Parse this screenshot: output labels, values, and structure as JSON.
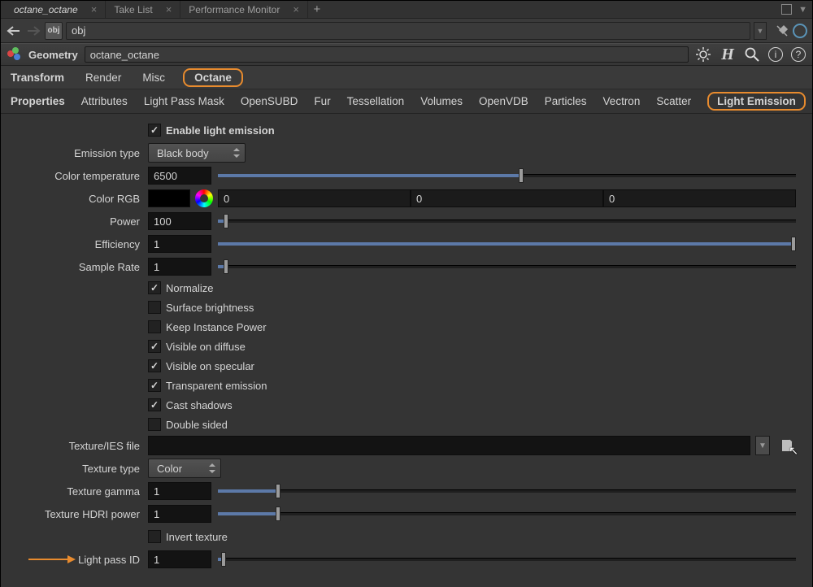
{
  "app_tabs": {
    "items": [
      {
        "label": "octane_octane",
        "italic": true
      },
      {
        "label": "Take List",
        "italic": false
      },
      {
        "label": "Performance Monitor",
        "italic": false
      }
    ]
  },
  "path": {
    "value": "obj"
  },
  "node": {
    "type_label": "Geometry",
    "name": "octane_octane"
  },
  "main_tabs": {
    "items": [
      "Transform",
      "Render",
      "Misc",
      "Octane"
    ],
    "active": "Octane",
    "bold": "Transform"
  },
  "sub_tabs": {
    "items": [
      "Properties",
      "Attributes",
      "Light Pass Mask",
      "OpenSUBD",
      "Fur",
      "Tessellation",
      "Volumes",
      "OpenVDB",
      "Particles",
      "Vectron",
      "Scatter",
      "Light Emission"
    ],
    "bold": "Properties",
    "active": "Light Emission"
  },
  "enable": {
    "label": "Enable light emission",
    "checked": true
  },
  "emission_type": {
    "label": "Emission type",
    "value": "Black body"
  },
  "color_temp": {
    "label": "Color temperature",
    "value": "6500",
    "fill": 0.52
  },
  "color_rgb": {
    "label": "Color RGB",
    "r": "0",
    "g": "0",
    "b": "0"
  },
  "power": {
    "label": "Power",
    "value": "100",
    "fill": 0.01
  },
  "efficiency": {
    "label": "Efficiency",
    "value": "1",
    "fill": 1.0
  },
  "sample_rate": {
    "label": "Sample Rate",
    "value": "1",
    "fill": 0.01
  },
  "flags": [
    {
      "label": "Normalize",
      "checked": true
    },
    {
      "label": "Surface brightness",
      "checked": false
    },
    {
      "label": "Keep Instance Power",
      "checked": false
    },
    {
      "label": "Visible on diffuse",
      "checked": true
    },
    {
      "label": "Visible on specular",
      "checked": true
    },
    {
      "label": "Transparent emission",
      "checked": true
    },
    {
      "label": "Cast shadows",
      "checked": true
    },
    {
      "label": "Double sided",
      "checked": false
    }
  ],
  "texture_file": {
    "label": "Texture/IES file",
    "value": ""
  },
  "texture_type": {
    "label": "Texture type",
    "value": "Color"
  },
  "tex_gamma": {
    "label": "Texture gamma",
    "value": "1",
    "fill": 0.1
  },
  "tex_hdri": {
    "label": "Texture HDRI power",
    "value": "1",
    "fill": 0.1
  },
  "invert_tex": {
    "label": "Invert texture",
    "checked": false
  },
  "light_pass": {
    "label": "Light pass ID",
    "value": "1",
    "fill": 0.005
  }
}
